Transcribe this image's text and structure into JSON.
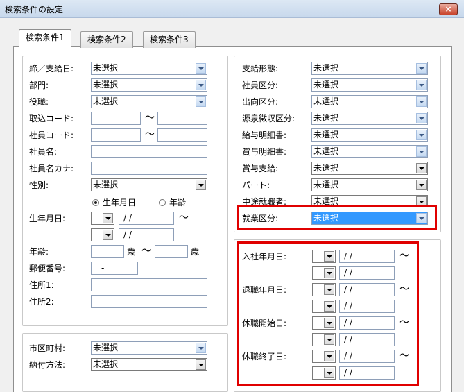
{
  "window": {
    "title": "検索条件の設定",
    "close_label": "×"
  },
  "tabs": [
    "検索条件1",
    "検索条件2",
    "検索条件3"
  ],
  "left": {
    "shimebi": {
      "label": "締／支給日:",
      "value": "未選択"
    },
    "bumon": {
      "label": "部門:",
      "value": "未選択"
    },
    "yakushoku": {
      "label": "役職:",
      "value": "未選択"
    },
    "torikomi": {
      "label": "取込コード:"
    },
    "shain_code": {
      "label": "社員コード:"
    },
    "shain_name": {
      "label": "社員名:"
    },
    "shain_kana": {
      "label": "社員名カナ:"
    },
    "seibetsu": {
      "label": "性別:",
      "value": "未選択"
    },
    "radio_birth": "生年月日",
    "radio_age": "年齢",
    "birthdate": {
      "label": "生年月日:",
      "date": "/ /",
      "date2": "/ /"
    },
    "age": {
      "label": "年齢:",
      "unit": "歳",
      "unit2": "歳"
    },
    "postal": {
      "label": "郵便番号:",
      "value": "-"
    },
    "address1": {
      "label": "住所1:"
    },
    "address2": {
      "label": "住所2:"
    },
    "tilde": "～"
  },
  "left_bottom": {
    "shikuchoson": {
      "label": "市区町村:",
      "value": "未選択"
    },
    "nofu": {
      "label": "納付方法:",
      "value": "未選択"
    }
  },
  "right": {
    "shikyu_keitai": {
      "label": "支給形態:",
      "value": "未選択"
    },
    "shain_kubun": {
      "label": "社員区分:",
      "value": "未選択"
    },
    "shukko": {
      "label": "出向区分:",
      "value": "未選択"
    },
    "gensen": {
      "label": "源泉徴収区分:",
      "value": "未選択"
    },
    "kyuyo_meisai": {
      "label": "給与明細書:",
      "value": "未選択"
    },
    "shoyo_meisai": {
      "label": "賞与明細書:",
      "value": "未選択"
    },
    "shoyo_shikyu": {
      "label": "賞与支給:",
      "value": "未選択"
    },
    "part": {
      "label": "パート:",
      "value": "未選択"
    },
    "chuto": {
      "label": "中途就職者:",
      "value": "未選択"
    },
    "shugyo": {
      "label": "就業区分:",
      "value": "未選択"
    }
  },
  "dates": {
    "nyusha": {
      "label": "入社年月日:",
      "from": "/ /",
      "to": "/ /"
    },
    "taishoku": {
      "label": "退職年月日:",
      "from": "/ /",
      "to": "/ /"
    },
    "kyushoku_start": {
      "label": "休職開始日:",
      "from": "/ /",
      "to": "/ /"
    },
    "kyushoku_end": {
      "label": "休職終了日:",
      "from": "/ /",
      "to": "/ /"
    },
    "tilde": "～"
  },
  "colors": {
    "highlight_red": "#e00000",
    "selected_blue": "#3399ff"
  }
}
